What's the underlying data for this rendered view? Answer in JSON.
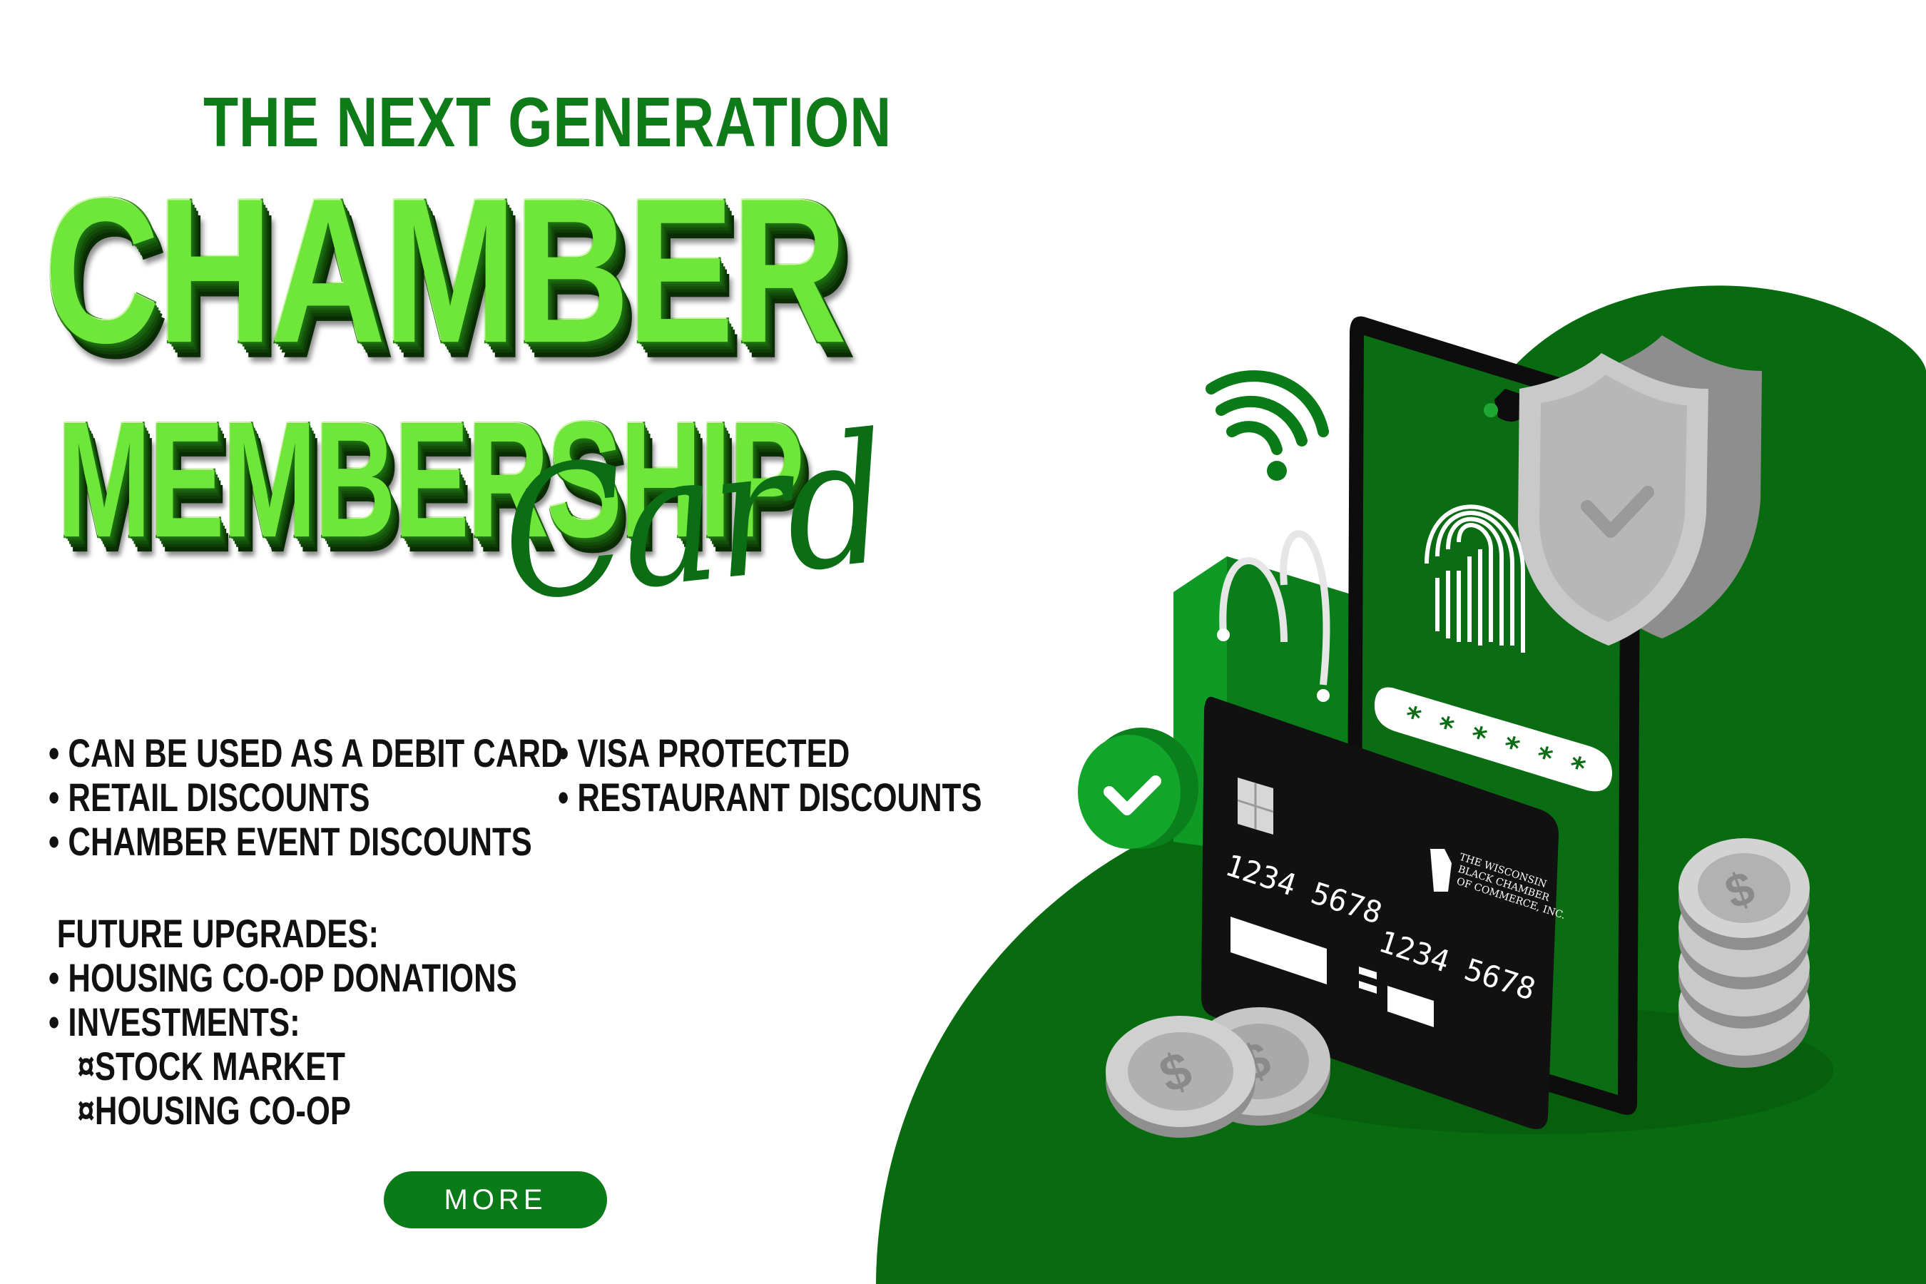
{
  "header": {
    "kicker": "THE NEXT GENERATION",
    "title_line1": "CHAMBER",
    "title_line2": "MEMBERSHIP",
    "title_script": "Card"
  },
  "features": {
    "left": [
      "• CAN BE USED AS A DEBIT CARD",
      "• RETAIL DISCOUNTS",
      "• CHAMBER EVENT DISCOUNTS"
    ],
    "right": [
      "• VISA PROTECTED",
      "• RESTAURANT DISCOUNTS"
    ]
  },
  "future": {
    "heading": "FUTURE UPGRADES:",
    "items": [
      "• HOUSING CO-OP DONATIONS",
      "• INVESTMENTS:"
    ],
    "sub_items": [
      "¤STOCK MARKET",
      "¤HOUSING CO-OP"
    ]
  },
  "cta": {
    "label": "MORE"
  },
  "illustration": {
    "card_number_top": "1234  5678",
    "card_number_bottom": "1234  5678",
    "card_issuer": [
      "THE WISCONSIN",
      "BLACK CHAMBER",
      "OF COMMERCE, INC."
    ],
    "password_mask": "* * * * * *",
    "dollar_sign": "$",
    "icons": [
      "wifi-icon",
      "shield-check-icon",
      "fingerprint-icon",
      "shopping-bag-icon",
      "check-badge-icon",
      "coin-stack-icon"
    ]
  },
  "colors": {
    "brand_green": "#0b7a18",
    "bright_green": "#6fe63a",
    "dark_green": "#006b0f",
    "card_black": "#111111",
    "shield_gray": "#c7c7c7"
  }
}
